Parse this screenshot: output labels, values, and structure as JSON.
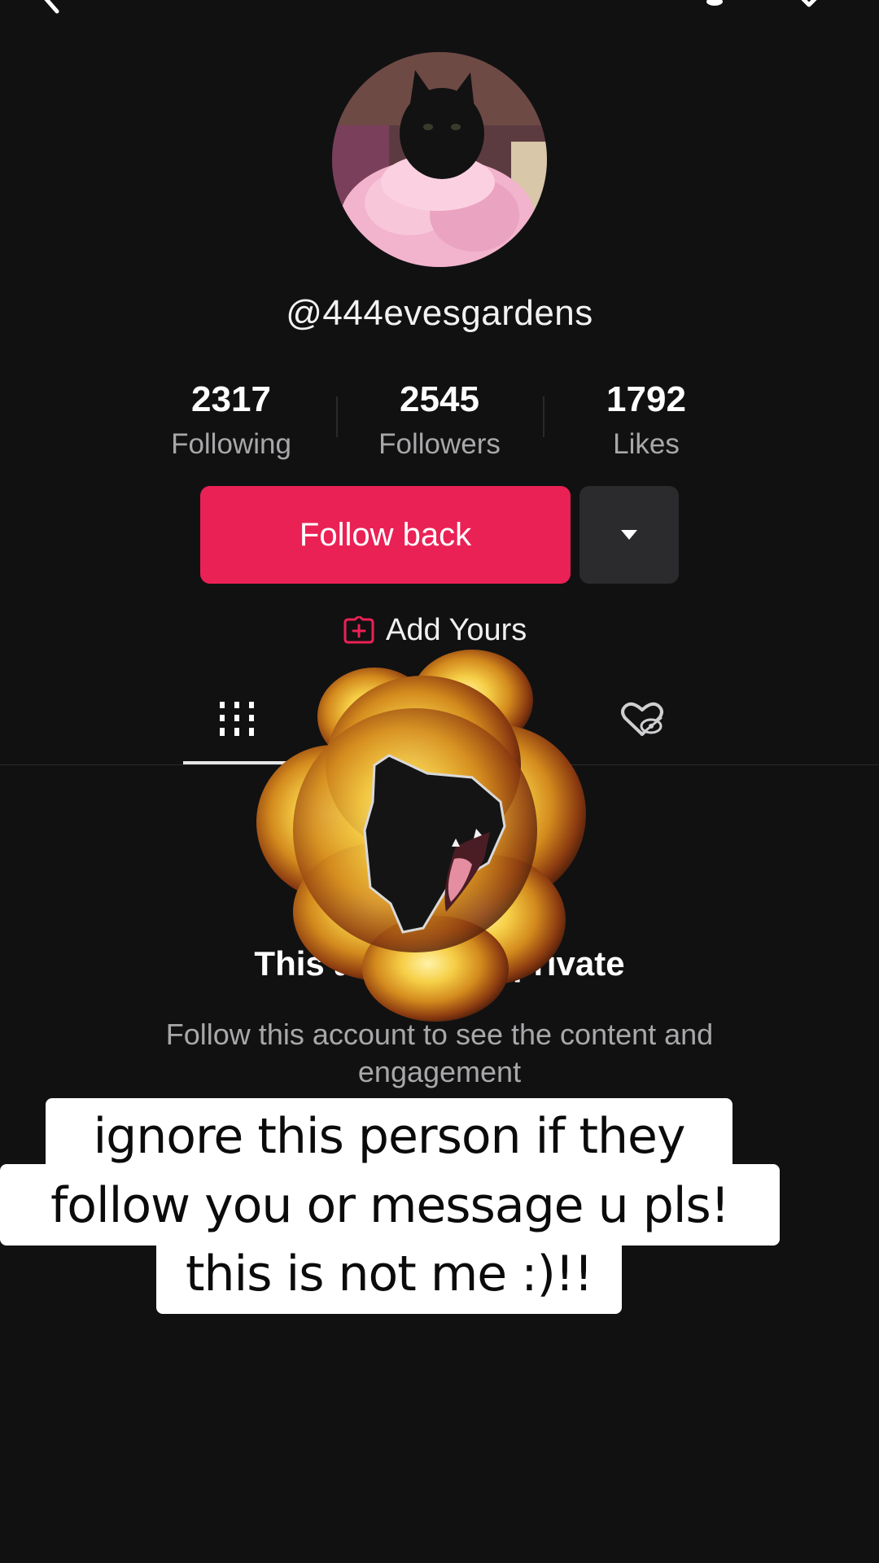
{
  "profile": {
    "username": "@444evesgardens",
    "avatar_alt": "black cat in pink feather boa"
  },
  "stats": [
    {
      "value": "2317",
      "label": "Following"
    },
    {
      "value": "2545",
      "label": "Followers"
    },
    {
      "value": "1792",
      "label": "Likes"
    }
  ],
  "actions": {
    "follow_label": "Follow back",
    "add_yours_label": "Add Yours"
  },
  "private": {
    "title": "This account is private",
    "subtitle_line1": "Follow this account to see the content and",
    "subtitle_line2": "engagement"
  },
  "caption": {
    "line1": "ignore this person if they",
    "line2": "follow you or message u pls!",
    "line3": "this is not me :)!!"
  },
  "icons": {
    "back": "back-arrow-icon",
    "notification": "bell-icon",
    "share": "share-icon",
    "dropdown": "caret-down-icon",
    "add_yours": "add-yours-icon",
    "grid": "grid-icon",
    "liked": "liked-hidden-icon"
  },
  "colors": {
    "background": "#111112",
    "accent": "#ea2155",
    "secondary_button": "#2b2b2d"
  }
}
